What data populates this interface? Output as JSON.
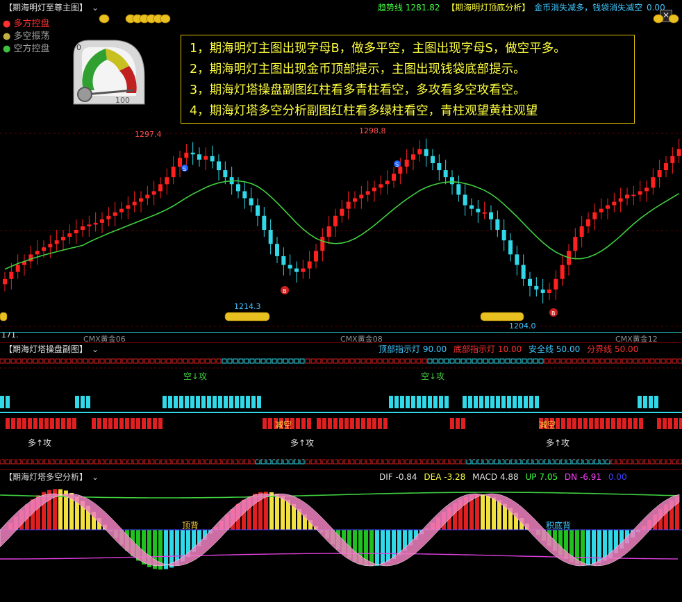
{
  "main": {
    "title": "【期海明灯至尊主图】",
    "trend_label": "趋势线",
    "trend_value": "1281.82",
    "subtitle": "【期海明灯顶底分析】",
    "coin_text": "金币消失减多，钱袋消失减空",
    "coin_value": "0.00",
    "legend": [
      "多方控盘",
      "多空振荡",
      "空方控盘"
    ],
    "legend_colors": [
      "#ff3030",
      "#c0b040",
      "#40c040"
    ],
    "gauge_min": "0",
    "gauge_max": "100",
    "notes": [
      "1，期海明灯主图出现字母B，做多平空，主图出现字母S，做空平多。",
      "2，期海明灯主图出现金币顶部提示，主图出现钱袋底部提示。",
      "3，期海灯塔操盘副图红柱看多青柱看空，多攻看多空攻看空。",
      "4，期海灯塔多空分析副图红柱看多绿柱看空，青柱观望黄柱观望"
    ],
    "high_label_1": "1297.4",
    "high_label_2": "1298.8",
    "low_label_1": "1214.3",
    "low_label_2": "1204.0",
    "left_label": "171.",
    "x_ticks": [
      "CMX黄金06",
      "CMX黄金08",
      "CMX黄金12"
    ]
  },
  "sub1": {
    "title": "【期海灯塔操盘副图】",
    "items": [
      {
        "label": "顶部指示灯",
        "value": "90.00",
        "color": "#40c8ff"
      },
      {
        "label": "底部指示灯",
        "value": "10.00",
        "color": "#ff3030"
      },
      {
        "label": "安全线",
        "value": "50.00",
        "color": "#40c8ff"
      },
      {
        "label": "分界线",
        "value": "50.00",
        "color": "#ff3030"
      }
    ],
    "short_attack": "空↓攻",
    "long_attack": "多↑攻",
    "reduce_short": "减空"
  },
  "sub2": {
    "title": "【期海灯塔多空分析】",
    "items": [
      {
        "label": "DIF",
        "value": "-0.84",
        "color": "#e0e0e0"
      },
      {
        "label": "DEA",
        "value": "-3.28",
        "color": "#ffff40"
      },
      {
        "label": "MACD",
        "value": "4.88",
        "color": "#e0e0e0"
      },
      {
        "label": "UP",
        "value": "7.05",
        "color": "#40ff40"
      },
      {
        "label": "DN",
        "value": "-6.91",
        "color": "#ff40ff"
      },
      {
        "label": "",
        "value": "0.00",
        "color": "#4040ff"
      }
    ],
    "top_div": "顶背",
    "bottom_div": "积底背"
  },
  "chart_data": {
    "type": "candlestick",
    "ylabel": "",
    "high_marks": [
      1297.4,
      1298.8
    ],
    "low_marks": [
      1214.3,
      1204.0
    ],
    "trend_value": 1281.82,
    "close": [
      1222,
      1226,
      1230,
      1232,
      1236,
      1238,
      1240,
      1242,
      1244,
      1246,
      1248,
      1250,
      1252,
      1253,
      1254,
      1256,
      1258,
      1260,
      1262,
      1264,
      1266,
      1268,
      1270,
      1272,
      1276,
      1280,
      1286,
      1291,
      1294,
      1293,
      1290,
      1292,
      1289,
      1284,
      1280,
      1276,
      1272,
      1268,
      1264,
      1258,
      1250,
      1242,
      1235,
      1230,
      1228,
      1226,
      1228,
      1232,
      1238,
      1246,
      1252,
      1258,
      1262,
      1266,
      1268,
      1270,
      1272,
      1274,
      1276,
      1278,
      1282,
      1286,
      1290,
      1293,
      1296,
      1292,
      1288,
      1284,
      1280,
      1276,
      1270,
      1264,
      1262,
      1260,
      1260,
      1256,
      1250,
      1244,
      1236,
      1230,
      1222,
      1218,
      1216,
      1214,
      1216,
      1222,
      1230,
      1238,
      1246,
      1252,
      1256,
      1260,
      1262,
      1264,
      1266,
      1268,
      1270,
      1270,
      1272,
      1274,
      1280,
      1284,
      1288,
      1292,
      1296
    ]
  }
}
